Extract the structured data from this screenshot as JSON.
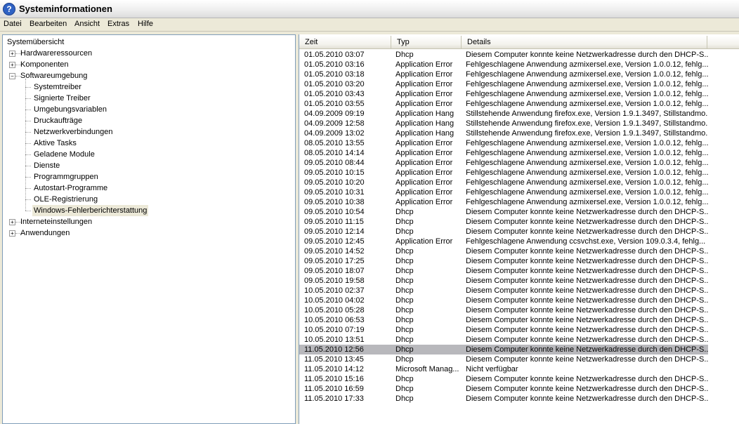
{
  "window": {
    "title": "Systeminformationen",
    "icon": "help-icon"
  },
  "menu": [
    "Datei",
    "Bearbeiten",
    "Ansicht",
    "Extras",
    "Hilfe"
  ],
  "tree": {
    "root": "Systemübersicht",
    "items": [
      {
        "label": "Hardwareressourcen",
        "level": 1,
        "expander": "+"
      },
      {
        "label": "Komponenten",
        "level": 1,
        "expander": "+"
      },
      {
        "label": "Softwareumgebung",
        "level": 1,
        "expander": "-"
      },
      {
        "label": "Systemtreiber",
        "level": 2
      },
      {
        "label": "Signierte Treiber",
        "level": 2
      },
      {
        "label": "Umgebungsvariablen",
        "level": 2
      },
      {
        "label": "Druckaufträge",
        "level": 2
      },
      {
        "label": "Netzwerkverbindungen",
        "level": 2
      },
      {
        "label": "Aktive Tasks",
        "level": 2
      },
      {
        "label": "Geladene Module",
        "level": 2
      },
      {
        "label": "Dienste",
        "level": 2
      },
      {
        "label": "Programmgruppen",
        "level": 2
      },
      {
        "label": "Autostart-Programme",
        "level": 2
      },
      {
        "label": "OLE-Registrierung",
        "level": 2
      },
      {
        "label": "Windows-Fehlerberichterstattung",
        "level": 2,
        "selected": true
      },
      {
        "label": "Interneteinstellungen",
        "level": 1,
        "expander": "+"
      },
      {
        "label": "Anwendungen",
        "level": 1,
        "expander": "+"
      }
    ]
  },
  "table": {
    "columns": [
      "Zeit",
      "Typ",
      "Details"
    ],
    "selected_row": 30,
    "rows": [
      [
        "01.05.2010 03:07",
        "Dhcp",
        "Diesem Computer konnte keine Netzwerkadresse durch den DHCP-S..."
      ],
      [
        "01.05.2010 03:16",
        "Application Error",
        "Fehlgeschlagene Anwendung azmixersel.exe, Version 1.0.0.12, fehlg..."
      ],
      [
        "01.05.2010 03:18",
        "Application Error",
        "Fehlgeschlagene Anwendung azmixersel.exe, Version 1.0.0.12, fehlg..."
      ],
      [
        "01.05.2010 03:20",
        "Application Error",
        "Fehlgeschlagene Anwendung azmixersel.exe, Version 1.0.0.12, fehlg..."
      ],
      [
        "01.05.2010 03:43",
        "Application Error",
        "Fehlgeschlagene Anwendung azmixersel.exe, Version 1.0.0.12, fehlg..."
      ],
      [
        "01.05.2010 03:55",
        "Application Error",
        "Fehlgeschlagene Anwendung azmixersel.exe, Version 1.0.0.12, fehlg..."
      ],
      [
        "04.09.2009 09:19",
        "Application Hang",
        "Stillstehende Anwendung firefox.exe, Version 1.9.1.3497, Stillstandmo..."
      ],
      [
        "04.09.2009 12:58",
        "Application Hang",
        "Stillstehende Anwendung firefox.exe, Version 1.9.1.3497, Stillstandmo..."
      ],
      [
        "04.09.2009 13:02",
        "Application Hang",
        "Stillstehende Anwendung firefox.exe, Version 1.9.1.3497, Stillstandmo..."
      ],
      [
        "08.05.2010 13:55",
        "Application Error",
        "Fehlgeschlagene Anwendung azmixersel.exe, Version 1.0.0.12, fehlg..."
      ],
      [
        "08.05.2010 14:14",
        "Application Error",
        "Fehlgeschlagene Anwendung azmixersel.exe, Version 1.0.0.12, fehlg..."
      ],
      [
        "09.05.2010 08:44",
        "Application Error",
        "Fehlgeschlagene Anwendung azmixersel.exe, Version 1.0.0.12, fehlg..."
      ],
      [
        "09.05.2010 10:15",
        "Application Error",
        "Fehlgeschlagene Anwendung azmixersel.exe, Version 1.0.0.12, fehlg..."
      ],
      [
        "09.05.2010 10:20",
        "Application Error",
        "Fehlgeschlagene Anwendung azmixersel.exe, Version 1.0.0.12, fehlg..."
      ],
      [
        "09.05.2010 10:31",
        "Application Error",
        "Fehlgeschlagene Anwendung azmixersel.exe, Version 1.0.0.12, fehlg..."
      ],
      [
        "09.05.2010 10:38",
        "Application Error",
        "Fehlgeschlagene Anwendung azmixersel.exe, Version 1.0.0.12, fehlg..."
      ],
      [
        "09.05.2010 10:54",
        "Dhcp",
        "Diesem Computer konnte keine Netzwerkadresse durch den DHCP-S..."
      ],
      [
        "09.05.2010 11:15",
        "Dhcp",
        "Diesem Computer konnte keine Netzwerkadresse durch den DHCP-S..."
      ],
      [
        "09.05.2010 12:14",
        "Dhcp",
        "Diesem Computer konnte keine Netzwerkadresse durch den DHCP-S..."
      ],
      [
        "09.05.2010 12:45",
        "Application Error",
        "Fehlgeschlagene Anwendung ccsvchst.exe, Version 109.0.3.4, fehlg..."
      ],
      [
        "09.05.2010 14:52",
        "Dhcp",
        "Diesem Computer konnte keine Netzwerkadresse durch den DHCP-S..."
      ],
      [
        "09.05.2010 17:25",
        "Dhcp",
        "Diesem Computer konnte keine Netzwerkadresse durch den DHCP-S..."
      ],
      [
        "09.05.2010 18:07",
        "Dhcp",
        "Diesem Computer konnte keine Netzwerkadresse durch den DHCP-S..."
      ],
      [
        "09.05.2010 19:58",
        "Dhcp",
        "Diesem Computer konnte keine Netzwerkadresse durch den DHCP-S..."
      ],
      [
        "10.05.2010 02:37",
        "Dhcp",
        "Diesem Computer konnte keine Netzwerkadresse durch den DHCP-S..."
      ],
      [
        "10.05.2010 04:02",
        "Dhcp",
        "Diesem Computer konnte keine Netzwerkadresse durch den DHCP-S..."
      ],
      [
        "10.05.2010 05:28",
        "Dhcp",
        "Diesem Computer konnte keine Netzwerkadresse durch den DHCP-S..."
      ],
      [
        "10.05.2010 06:53",
        "Dhcp",
        "Diesem Computer konnte keine Netzwerkadresse durch den DHCP-S..."
      ],
      [
        "10.05.2010 07:19",
        "Dhcp",
        "Diesem Computer konnte keine Netzwerkadresse durch den DHCP-S..."
      ],
      [
        "10.05.2010 13:51",
        "Dhcp",
        "Diesem Computer konnte keine Netzwerkadresse durch den DHCP-S..."
      ],
      [
        "11.05.2010 12:56",
        "Dhcp",
        "Diesem Computer konnte keine Netzwerkadresse durch den DHCP-S..."
      ],
      [
        "11.05.2010 13:45",
        "Dhcp",
        "Diesem Computer konnte keine Netzwerkadresse durch den DHCP-S..."
      ],
      [
        "11.05.2010 14:12",
        "Microsoft Manag...",
        "Nicht verfügbar"
      ],
      [
        "11.05.2010 15:16",
        "Dhcp",
        "Diesem Computer konnte keine Netzwerkadresse durch den DHCP-S..."
      ],
      [
        "11.05.2010 16:59",
        "Dhcp",
        "Diesem Computer konnte keine Netzwerkadresse durch den DHCP-S..."
      ],
      [
        "11.05.2010 17:33",
        "Dhcp",
        "Diesem Computer konnte keine Netzwerkadresse durch den DHCP-S..."
      ]
    ]
  }
}
